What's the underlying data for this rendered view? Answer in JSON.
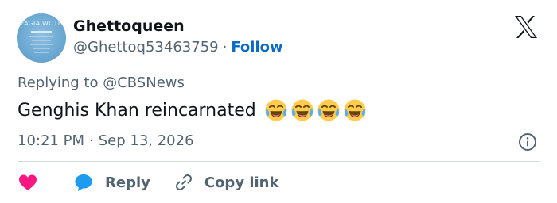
{
  "author": {
    "display_name": "Ghettoqueen",
    "handle": "@Ghettoq53463759",
    "separator": "·",
    "follow_label": "Follow",
    "avatar_text": "FAGIA WOTE"
  },
  "replying": {
    "text": "Replying to @CBSNews"
  },
  "tweet": {
    "text": "Genghis Khan reincarnated",
    "emojis": [
      "face-with-tears-of-joy",
      "face-with-tears-of-joy",
      "face-with-tears-of-joy",
      "face-with-tears-of-joy"
    ]
  },
  "meta": {
    "time": "10:21 PM",
    "separator": "·",
    "date": "Sep 13, 2026"
  },
  "actions": {
    "reply_label": "Reply",
    "copy_link_label": "Copy link"
  },
  "colors": {
    "text_primary": "#0f1419",
    "text_secondary": "#536471",
    "link": "#0a6bc4",
    "like": "#f91880",
    "reply": "#1d9bf0",
    "divider": "#cfd9de"
  },
  "icons": {
    "brand": "x-logo-icon",
    "info": "info-icon",
    "like": "heart-icon",
    "reply": "speech-bubble-icon",
    "copy": "link-icon"
  }
}
